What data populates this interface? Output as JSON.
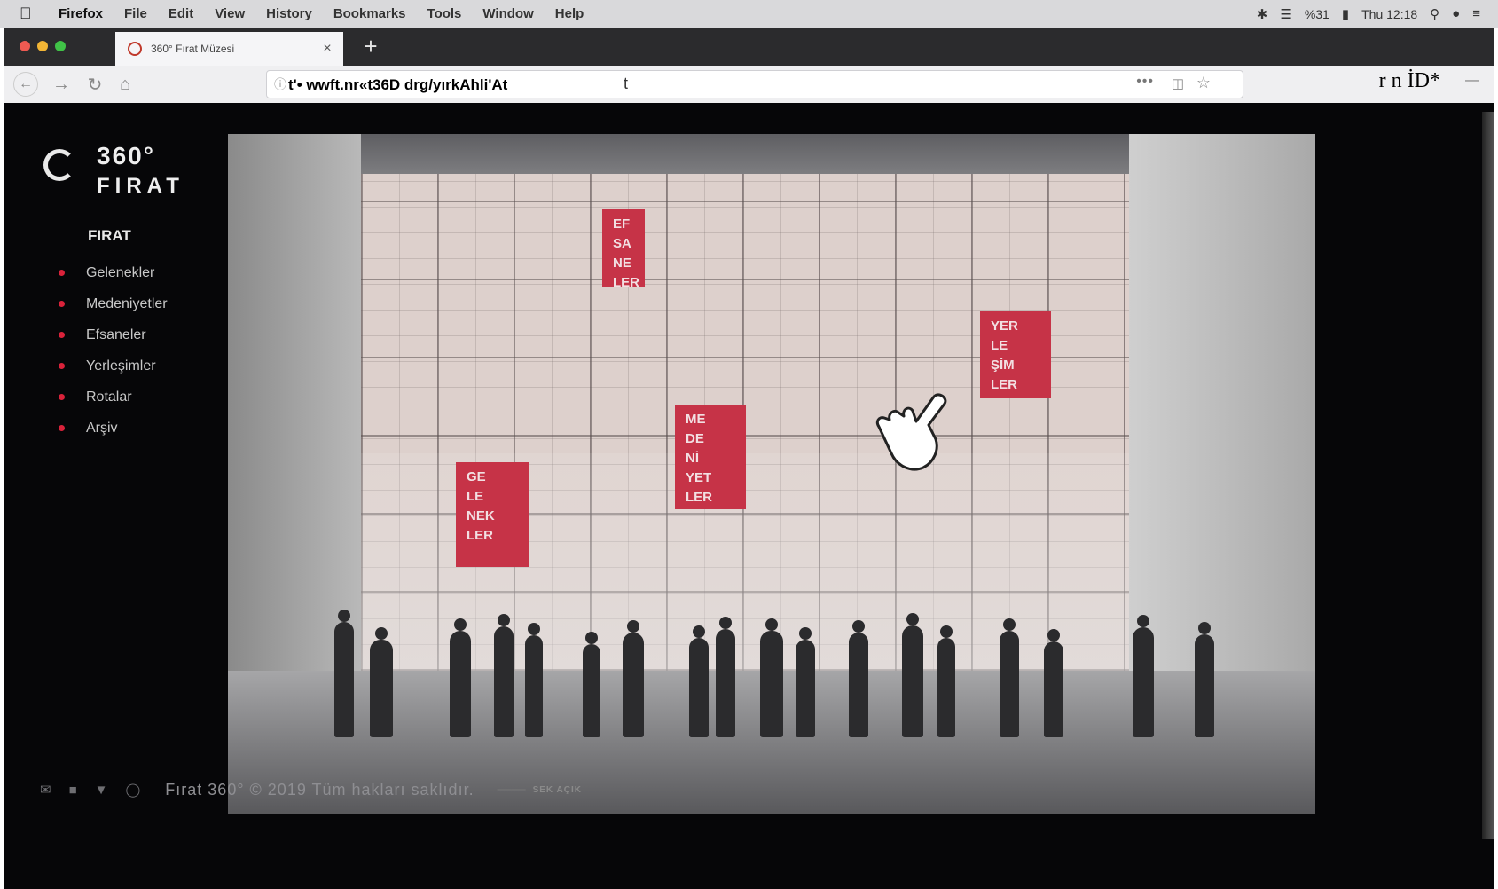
{
  "menubar": {
    "apple": "",
    "app": "Firefox",
    "items": [
      "File",
      "Edit",
      "View",
      "History",
      "Bookmarks",
      "Tools",
      "Window",
      "Help"
    ],
    "battery": "%31",
    "clock": "Thu 12:18"
  },
  "tab": {
    "title": "360° Fırat Müzesi",
    "close": "×",
    "new_tab": "+"
  },
  "navbar": {
    "url": "t'• wwft.nr«t36D drg/yırkAhli'At",
    "cursor": "t",
    "page_actions": "•••",
    "toolbar_right": "r  n İD*",
    "menu": "—"
  },
  "site": {
    "logo_line1": "360°",
    "logo_line2": "FIRAT",
    "nav_heading": "FIRAT",
    "nav_items": [
      "Gelenekler",
      "Medeniyetler",
      "Efsaneler",
      "Yerleşimler",
      "Rotalar",
      "Arşiv"
    ],
    "panels": {
      "ef": [
        "EF",
        "SA",
        "NE",
        "LER"
      ],
      "yer": [
        "YER",
        "LE",
        "ŞİM",
        "LER"
      ],
      "me": [
        "ME",
        "DE",
        "Nİ",
        "YET",
        "LER"
      ],
      "ge": [
        "GE",
        "LE",
        "NEK",
        "LER"
      ]
    },
    "footer": {
      "copyright": "Fırat 360° © 2019 Tüm hakları saklıdır.",
      "made_by": "SEK AÇIK"
    }
  },
  "colors": {
    "accent_red": "#c63347",
    "nav_dot": "#d9223a"
  }
}
